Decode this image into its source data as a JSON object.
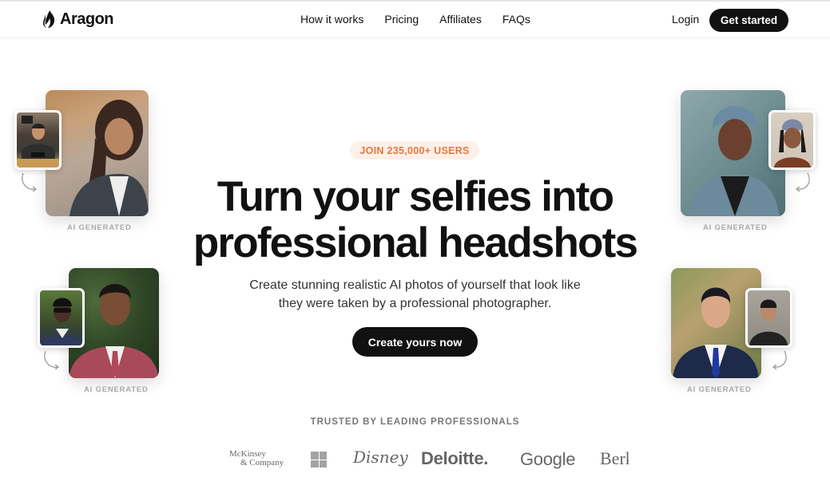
{
  "nav": {
    "brand": "Aragon",
    "links": [
      "How it works",
      "Pricing",
      "Affiliates",
      "FAQs"
    ],
    "login": "Login",
    "get_started": "Get started"
  },
  "hero": {
    "badge": "JOIN 235,000+ USERS",
    "headline_line1": "Turn your selfies into",
    "headline_line2": "professional headshots",
    "subtext_line1": "Create stunning realistic AI photos of yourself that look like",
    "subtext_line2": "they were taken by a professional photographer.",
    "cta": "Create yours now"
  },
  "examples": [
    {
      "label": "AI GENERATED",
      "position": "top-left",
      "generated": "woman in dark blazer, autumn background",
      "selfie": "man at table holding phone"
    },
    {
      "label": "AI GENERATED",
      "position": "bottom-left",
      "generated": "man in maroon suit, green background",
      "selfie": "man with sunglasses"
    },
    {
      "label": "AI GENERATED",
      "position": "top-right",
      "generated": "woman in blue head wrap",
      "selfie": "woman with headband selfie"
    },
    {
      "label": "AI GENERATED",
      "position": "bottom-right",
      "generated": "man in navy suit and blue tie",
      "selfie": "man in dark shirt"
    }
  ],
  "trusted": {
    "title": "TRUSTED BY LEADING PROFESSIONALS",
    "logos": {
      "mckinsey_line1": "McKinsey",
      "mckinsey_line2": "& Company",
      "microsoft": "microsoft-logo",
      "disney": "Disney",
      "deloitte": "Deloitte.",
      "google": "Google",
      "berkeley": "Berkeley"
    }
  },
  "colors": {
    "accent_badge_text": "#e07a3f",
    "accent_badge_bg": "#fdf0e8",
    "primary_button": "#111111"
  }
}
